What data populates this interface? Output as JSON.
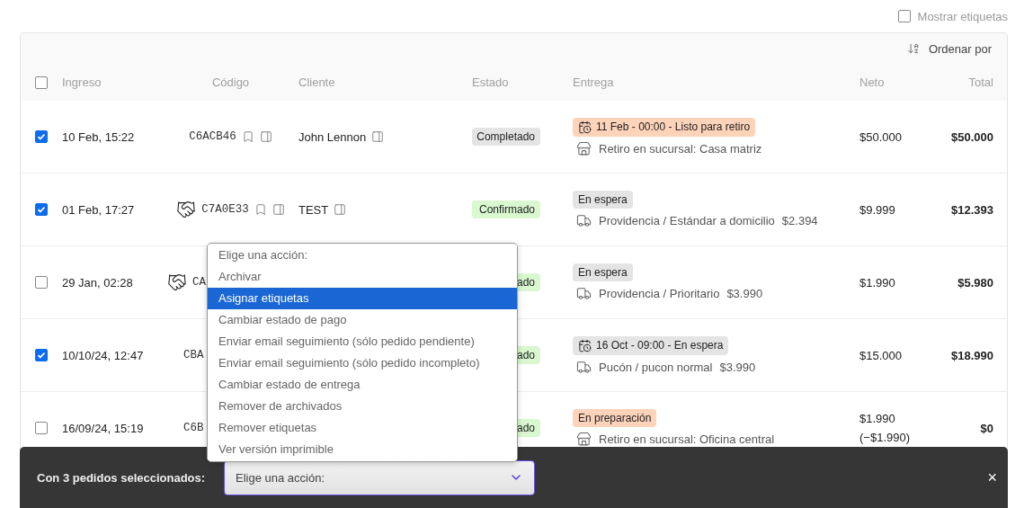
{
  "labels_toggle": {
    "label": "Mostrar etiquetas",
    "checked": false
  },
  "sort": {
    "label": "Ordenar por"
  },
  "table": {
    "select_all": {
      "checked": false
    },
    "columns": [
      "Ingreso",
      "Código",
      "Cliente",
      "Estado",
      "Entrega",
      "Neto",
      "Total"
    ],
    "rows": [
      {
        "selected": true,
        "ingreso": "10 Feb, 15:22",
        "code": {
          "text": "C6ACB46",
          "handshake": false,
          "actions": true
        },
        "client": {
          "text": "John Lennon",
          "panel": true
        },
        "status": {
          "label": "Completado",
          "color": "#e4e4e4"
        },
        "delivery": {
          "badge": {
            "kind": "scheduled",
            "label": "11 Feb - 00:00 - Listo para retiro",
            "color": "#fdd3ba"
          },
          "method": {
            "kind": "pickup",
            "text": "Retiro en sucursal: Casa matriz"
          }
        },
        "neto": [
          "$50.000"
        ],
        "total": "$50.000"
      },
      {
        "selected": true,
        "ingreso": "01 Feb, 17:27",
        "code": {
          "text": "C7A0E33",
          "handshake": true,
          "actions": true
        },
        "client": {
          "text": "TEST",
          "panel": true
        },
        "status": {
          "label": "Confirmado",
          "color": "#d9f8cf"
        },
        "delivery": {
          "badge": {
            "kind": "status",
            "label": "En espera",
            "color": "#e4e4e4"
          },
          "method": {
            "kind": "shipping",
            "text": "Providencia / Estándar a domicilio",
            "price": "$2.394"
          }
        },
        "neto": [
          "$9.999"
        ],
        "total": "$12.393"
      },
      {
        "selected": false,
        "ingreso": "29 Jan, 02:28",
        "code": {
          "text": "CA",
          "handshake": true,
          "actions": false
        },
        "status": {
          "label": "ado",
          "color": "#d9f8cf"
        },
        "delivery": {
          "badge": {
            "kind": "status",
            "label": "En espera",
            "color": "#e4e4e4"
          },
          "method": {
            "kind": "shipping",
            "text": "Providencia / Prioritario",
            "price": "$3.990"
          }
        },
        "neto": [
          "$1.990"
        ],
        "total": "$5.980"
      },
      {
        "selected": true,
        "ingreso": "10/10/24, 12:47",
        "code": {
          "text": "CBA",
          "handshake": false,
          "actions": false
        },
        "status": {
          "label": "ado",
          "color": "#d9f8cf"
        },
        "delivery": {
          "badge": {
            "kind": "scheduled",
            "label": "16 Oct - 09:00 - En espera",
            "color": "#e4e4e4"
          },
          "method": {
            "kind": "shipping",
            "text": "Pucón / pucon normal",
            "price": "$3.990"
          }
        },
        "neto": [
          "$15.000"
        ],
        "total": "$18.990"
      },
      {
        "selected": false,
        "ingreso": "16/09/24, 15:19",
        "code": {
          "text": "C6B",
          "handshake": false,
          "actions": false
        },
        "status": {
          "label": "ado",
          "color": "#d9f8cf"
        },
        "delivery": {
          "badge": {
            "kind": "status",
            "label": "En preparación",
            "color": "#fdd3ba"
          },
          "method": {
            "kind": "pickup",
            "text": "Retiro en sucursal: Oficina central"
          }
        },
        "neto": [
          "$1.990",
          "(−$1.990)"
        ],
        "total": "$0"
      }
    ]
  },
  "bulk_bar": {
    "label": "Con 3 pedidos seleccionados:",
    "select": {
      "value": "Elige una acción:"
    },
    "close": "×",
    "menu": [
      {
        "label": "Elige una acción:",
        "selected": false
      },
      {
        "label": "Archivar",
        "selected": false
      },
      {
        "label": "Asignar etiquetas",
        "selected": true
      },
      {
        "label": "Cambiar estado de pago",
        "selected": false
      },
      {
        "label": "Enviar email seguimiento (sólo pedido pendiente)",
        "selected": false
      },
      {
        "label": "Enviar email seguimiento (sólo pedido incompleto)",
        "selected": false
      },
      {
        "label": "Cambiar estado de entrega",
        "selected": false
      },
      {
        "label": "Remover de archivados",
        "selected": false
      },
      {
        "label": "Remover etiquetas",
        "selected": false
      },
      {
        "label": "Ver versión imprimible",
        "selected": false
      }
    ]
  }
}
